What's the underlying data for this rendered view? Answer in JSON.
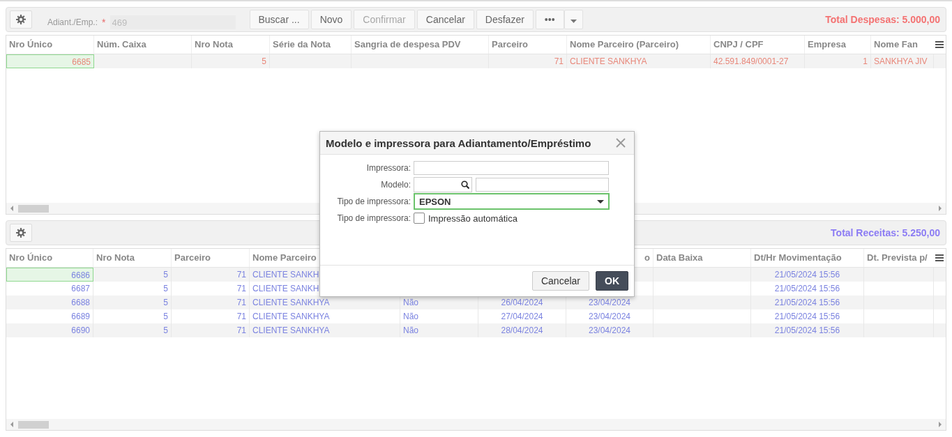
{
  "expenses_panel": {
    "toolbar": {
      "field": {
        "label": "Adiant./Emp.:",
        "required_mark": "*",
        "value": "469"
      },
      "buttons": [
        {
          "label": "Buscar ...",
          "disabled": false
        },
        {
          "label": "Novo",
          "disabled": false
        },
        {
          "label": "Confirmar",
          "disabled": true
        },
        {
          "label": "Cancelar",
          "disabled": false
        },
        {
          "label": "Desfazer",
          "disabled": false
        },
        {
          "label": "•••",
          "disabled": false
        }
      ],
      "total": "Total Despesas: 5.000,00"
    },
    "table": {
      "columns": [
        {
          "label": "Nro Único"
        },
        {
          "label": "Núm. Caixa"
        },
        {
          "label": "Nro Nota"
        },
        {
          "label": "Série da Nota"
        },
        {
          "label": "Sangria de despesa PDV"
        },
        {
          "label": "Parceiro"
        },
        {
          "label": "Nome Parceiro (Parceiro)"
        },
        {
          "label": "CNPJ / CPF"
        },
        {
          "label": "Empresa"
        },
        {
          "label": "Nome Fan"
        }
      ],
      "rows": [
        {
          "selected": true,
          "cells": [
            "6685",
            "",
            "5",
            "",
            "",
            "71",
            "CLIENTE SANKHYA",
            "42.591.849/0001-27",
            "1",
            "SANKHYA JIV"
          ]
        }
      ]
    }
  },
  "income_panel": {
    "toolbar": {
      "total": "Total Receitas: 5.250,00"
    },
    "table": {
      "columns": [
        {
          "label": "Nro Único"
        },
        {
          "label": "Nro Nota"
        },
        {
          "label": "Parceiro"
        },
        {
          "label": "Nome Parceiro"
        },
        {},
        {},
        {
          "label": "o"
        },
        {
          "label": "Data Baixa"
        },
        {
          "label": "Dt/Hr Movimentação"
        },
        {
          "label": "Dt. Prevista p/"
        }
      ],
      "rows": [
        {
          "selected": true,
          "cells": [
            "6686",
            "5",
            "71",
            "CLIENTE SANKH",
            "",
            "",
            "",
            "",
            "21/05/2024 15:56",
            ""
          ]
        },
        {
          "selected": false,
          "cells": [
            "6687",
            "5",
            "71",
            "CLIENTE SANKH",
            "",
            "",
            "",
            "",
            "21/05/2024 15:56",
            ""
          ]
        },
        {
          "selected": false,
          "cells": [
            "6688",
            "5",
            "71",
            "CLIENTE SANKHYA",
            "Não",
            "26/04/2024",
            "23/04/2024",
            "",
            "21/05/2024 15:56",
            ""
          ]
        },
        {
          "selected": false,
          "cells": [
            "6689",
            "5",
            "71",
            "CLIENTE SANKHYA",
            "Não",
            "27/04/2024",
            "23/04/2024",
            "",
            "21/05/2024 15:56",
            ""
          ]
        },
        {
          "selected": false,
          "cells": [
            "6690",
            "5",
            "71",
            "CLIENTE SANKHYA",
            "Não",
            "28/04/2024",
            "23/04/2024",
            "",
            "21/05/2024 15:56",
            ""
          ]
        }
      ]
    }
  },
  "dialog": {
    "title": "Modelo e impressora para Adiantamento/Empréstimo",
    "fields": [
      {
        "kind": "text",
        "label": "Impressora:"
      },
      {
        "kind": "lookup",
        "label": "Modelo:"
      },
      {
        "kind": "select",
        "label": "Tipo de impressora:",
        "value": "EPSON"
      },
      {
        "kind": "checkbox",
        "label": "Tipo de impressora:",
        "option": "Impressão automática",
        "checked": false
      }
    ],
    "buttons": [
      {
        "label": "Cancelar",
        "primary": false
      },
      {
        "label": "OK",
        "primary": true
      }
    ]
  }
}
